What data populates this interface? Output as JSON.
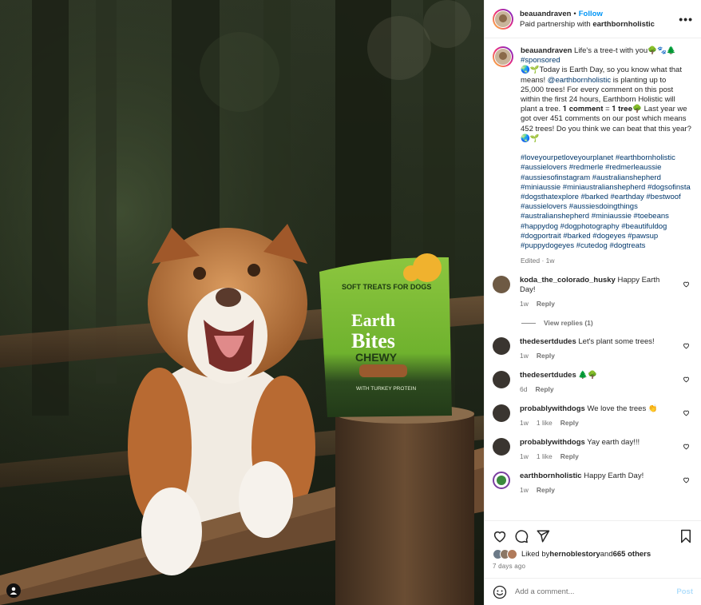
{
  "header": {
    "username": "beauandraven",
    "separator": "•",
    "follow_label": "Follow",
    "partnership_prefix": "Paid partnership with ",
    "partner": "earthbornholistic",
    "more_icon": "more-horizontal-icon"
  },
  "photo": {
    "product_top": "SOFT TREATS FOR DOGS",
    "product_brand_1": "Earth",
    "product_brand_2": "Bites",
    "product_variant": "CHEWY",
    "product_protein": "WITH TURKEY PROTEIN",
    "user_tag_icon": "person-icon"
  },
  "caption": {
    "username": "beauandraven",
    "text_1": " Life's a tree-t with you🌳🐾🌲",
    "hashtag_sponsored": "#sponsored",
    "text_2": "🌏🌱Today is Earth Day, so you know what that means! ",
    "mention": "@earthbornholistic",
    "text_3": " is planting up to 25,000 trees! For every comment on this post within the first 24 hours, Earthborn Holistic will plant a tree. 𝟏 𝐜𝐨𝐦𝐦𝐞𝐧𝐭 = 𝟏 𝐭𝐫𝐞𝐞🌳 Last year we got over 451 comments on our post which means 452 trees! Do you think we can beat that this year? 🌏🌱",
    "hashtags": "#loveyourpetloveyourplanet #earthbornholistic #aussielovers #redmerle #redmerleaussie #aussiesofinstagram #australianshepherd #miniaussie #miniaustralianshepherd #dogsofinsta #dogsthatexplore #barked #earthday #bestwoof #aussielovers #aussiesdoingthings #australianshepherd #miniaussie #toebeans #happydog #dogphotography #beautifuldog #dogportrait #barked #dogeyes #pawsup #puppydogeyes #cutedog #dogtreats",
    "edited": "Edited",
    "age": "1w"
  },
  "comments": [
    {
      "username": "koda_the_colorado_husky",
      "text": "Happy Earth Day!",
      "age": "1w",
      "likes": "",
      "reply": "Reply"
    },
    {
      "username": "thedesertdudes",
      "text": "Let's plant some trees!",
      "age": "1w",
      "likes": "",
      "reply": "Reply"
    },
    {
      "username": "thedesertdudes",
      "text": "🌲🌳",
      "age": "6d",
      "likes": "",
      "reply": "Reply"
    },
    {
      "username": "probablywithdogs",
      "text": "We love the trees 👏",
      "age": "1w",
      "likes": "1 like",
      "reply": "Reply"
    },
    {
      "username": "probablywithdogs",
      "text": "Yay earth day!!!",
      "age": "1w",
      "likes": "1 like",
      "reply": "Reply"
    },
    {
      "username": "earthbornholistic",
      "text": "Happy Earth Day!",
      "age": "1w",
      "likes": "",
      "reply": "Reply"
    }
  ],
  "view_replies": "View replies (1)",
  "likes": {
    "prefix": "Liked by ",
    "user": "hernoblestory",
    "middle": " and ",
    "others": "665 others"
  },
  "posted_ago": "7 days ago",
  "add_comment": {
    "placeholder": "Add a comment...",
    "post_label": "Post",
    "emoji_icon": "emoji-smile-icon"
  },
  "icons": {
    "like": "heart-icon",
    "comment": "comment-icon",
    "share": "send-icon",
    "save": "bookmark-icon"
  },
  "colors": {
    "link_blue": "#0095f6",
    "hashtag": "#00376b",
    "muted": "#737373",
    "post_disabled": "#b2dffc"
  }
}
